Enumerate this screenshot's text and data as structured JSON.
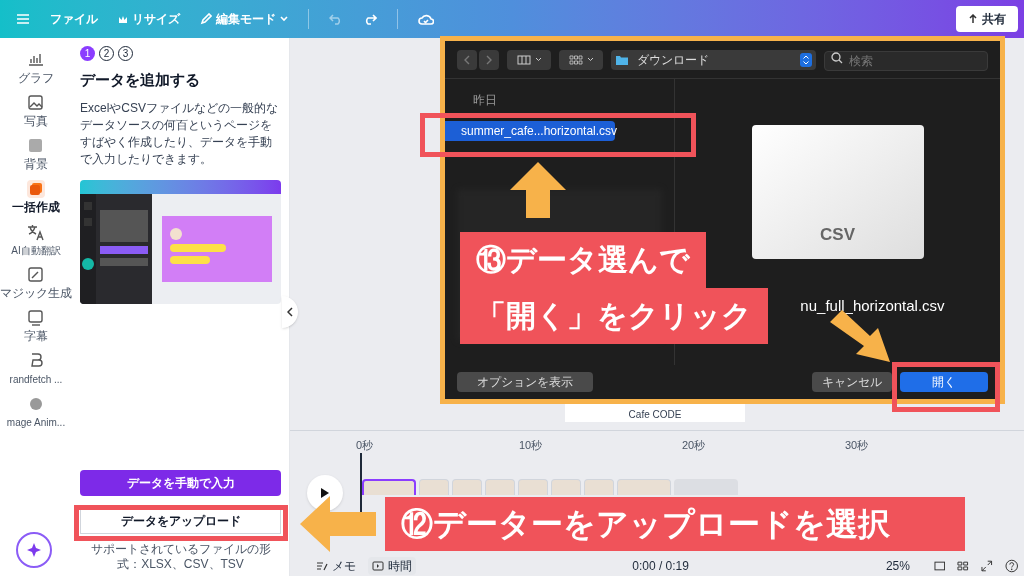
{
  "top_bar": {
    "items": [
      {
        "kind": "menu"
      },
      {
        "kind": "text",
        "label": "ファイル"
      },
      {
        "kind": "crown",
        "label": "リサイズ"
      },
      {
        "kind": "edit",
        "label": "編集モード"
      },
      {
        "kind": "undo"
      },
      {
        "kind": "redo"
      },
      {
        "kind": "cloud"
      }
    ],
    "share_button": "共有"
  },
  "rail": [
    {
      "label": "グラフ",
      "selected": false
    },
    {
      "label": "写真",
      "selected": false
    },
    {
      "label": "背景",
      "selected": false
    },
    {
      "label": "一括作成",
      "selected": true
    },
    {
      "label": "AI自動翻訳",
      "selected": false
    },
    {
      "label": "マジック生成",
      "selected": false
    },
    {
      "label": "字幕",
      "selected": false
    },
    {
      "label": "randfetch ...",
      "selected": false
    },
    {
      "label": "mage Anim...",
      "selected": false
    }
  ],
  "panel": {
    "steps": [
      {
        "label": "1",
        "selected": true
      },
      {
        "label": "2",
        "selected": false
      },
      {
        "label": "3",
        "selected": false
      }
    ],
    "title": "データを追加する",
    "description": "ExcelやCSVファイルなどの一般的なデータソースの何百というページをすばやく作成したり、データを手動で入力したりできます。",
    "buttons": [
      {
        "label": "データを手動で入力",
        "kind": "primary"
      },
      {
        "label": "データをアップロード",
        "kind": "secondary"
      }
    ],
    "support_note": "サポートされているファイルの形式：XLSX、CSV、TSV"
  },
  "canvas": {
    "card_label": "Cafe CODE"
  },
  "timeline": {
    "ticks": [
      "0秒",
      "10秒",
      "20秒",
      "30秒"
    ],
    "clips": [
      {
        "selected": true
      },
      {
        "selected": false
      },
      {
        "selected": false
      },
      {
        "selected": false
      },
      {
        "selected": false
      },
      {
        "selected": false
      },
      {
        "selected": false
      },
      {
        "selected": false
      }
    ],
    "notes_label": "メモ",
    "time_label": "時間",
    "playback_time": "0:00 / 0:19",
    "zoom": "25%"
  },
  "dialog": {
    "location": "ダウンロード",
    "search_placeholder": "検索",
    "section": "昨日",
    "files": [
      {
        "name": "summer_cafe...horizontal.csv",
        "selected": true
      }
    ],
    "preview": {
      "badge": "CSV",
      "filename": "nu_full_horizontal.csv"
    },
    "options_button": "オプションを表示",
    "buttons": [
      {
        "label": "キャンセル",
        "kind": "secondary"
      },
      {
        "label": "開く",
        "kind": "primary"
      }
    ]
  },
  "annotations": [
    {
      "kind": "callout",
      "lines": [
        "⑬データ選んで",
        "「開く」をクリック"
      ]
    },
    {
      "kind": "callout",
      "lines": [
        "⑫データーをアップロードを選択"
      ]
    }
  ]
}
